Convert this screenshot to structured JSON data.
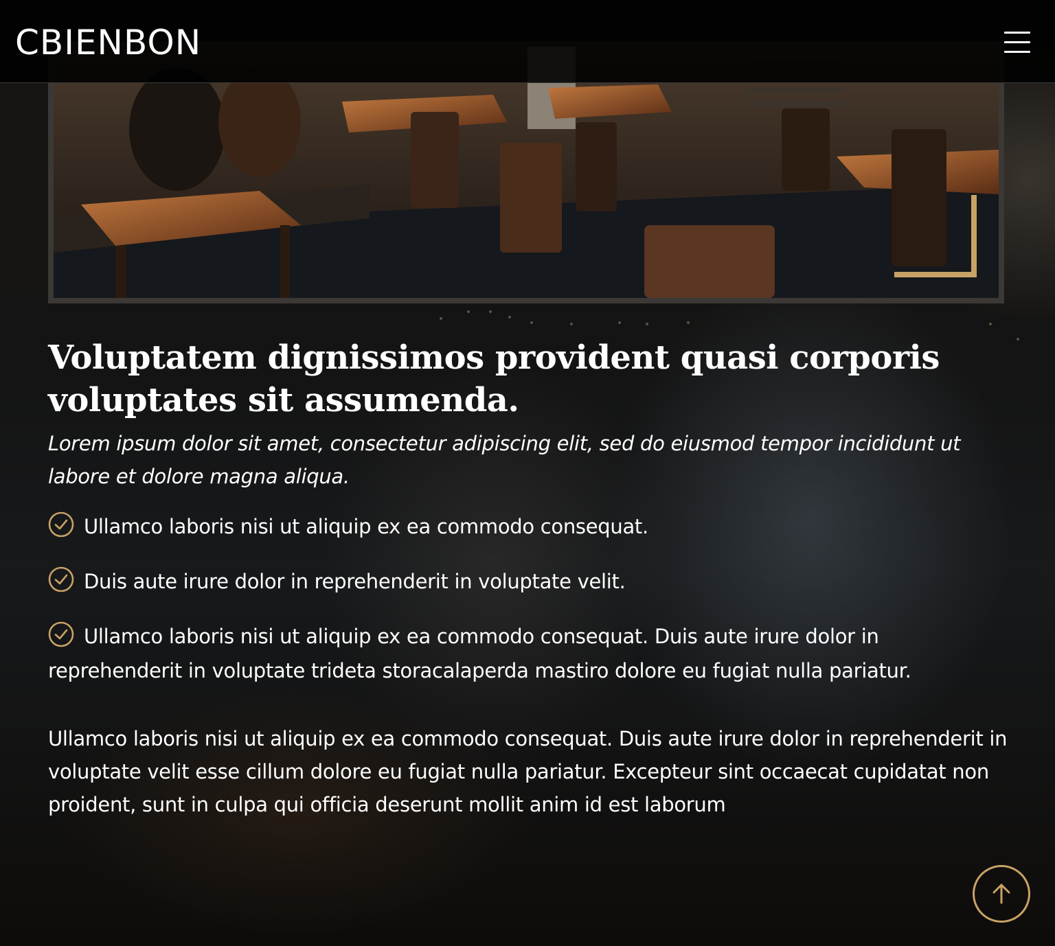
{
  "header": {
    "logo": "CBIENBON",
    "menu_icon": "hamburger-menu-icon"
  },
  "hero_image": {
    "description_icon": "restaurant-interior-photo",
    "accent_color": "#c9a266"
  },
  "about": {
    "headline": "Voluptatem dignissimos provident quasi corporis voluptates sit assumenda.",
    "lead": "Lorem ipsum dolor sit amet, consectetur adipiscing elit, sed do eiusmod tempor incididunt ut labore et dolore magna aliqua.",
    "checklist": [
      "Ullamco laboris nisi ut aliquip ex ea commodo consequat.",
      "Duis aute irure dolor in reprehenderit in voluptate velit.",
      "Ullamco laboris nisi ut aliquip ex ea commodo consequat. Duis aute irure dolor in reprehenderit in voluptate trideta storacalaperda mastiro dolore eu fugiat nulla pariatur."
    ],
    "body": "Ullamco laboris nisi ut aliquip ex ea commodo consequat. Duis aute irure dolor in reprehenderit in voluptate velit esse cillum dolore eu fugiat nulla pariatur. Excepteur sint occaecat cupidatat non proident, sunt in culpa qui officia deserunt mollit anim id est laborum"
  },
  "back_to_top": {
    "icon": "arrow-up-icon"
  },
  "colors": {
    "accent": "#c9a266",
    "background": "#0c0b0a",
    "text": "#ffffff"
  }
}
